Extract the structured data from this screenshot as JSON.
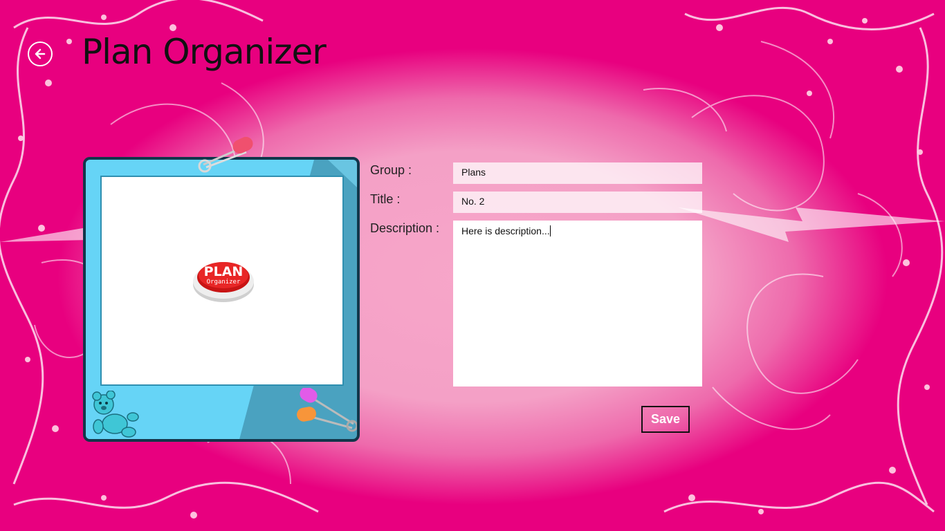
{
  "app": {
    "title": "Plan Organizer"
  },
  "nav": {
    "back_icon": "back-arrow-icon"
  },
  "logo": {
    "line1": "PLAN",
    "line2": "Organizer",
    "color": "#e01b1b"
  },
  "form": {
    "group_label": "Group :",
    "group_value": "Plans",
    "title_label": "Title :",
    "title_value": "No. 2",
    "description_label": "Description :",
    "description_value": "Here is description...",
    "save_label": "Save"
  },
  "colors": {
    "background_edge": "#e8007f",
    "background_center": "#f4a0c6",
    "frame": "#4aa2c0",
    "frame_border": "#12364a"
  }
}
